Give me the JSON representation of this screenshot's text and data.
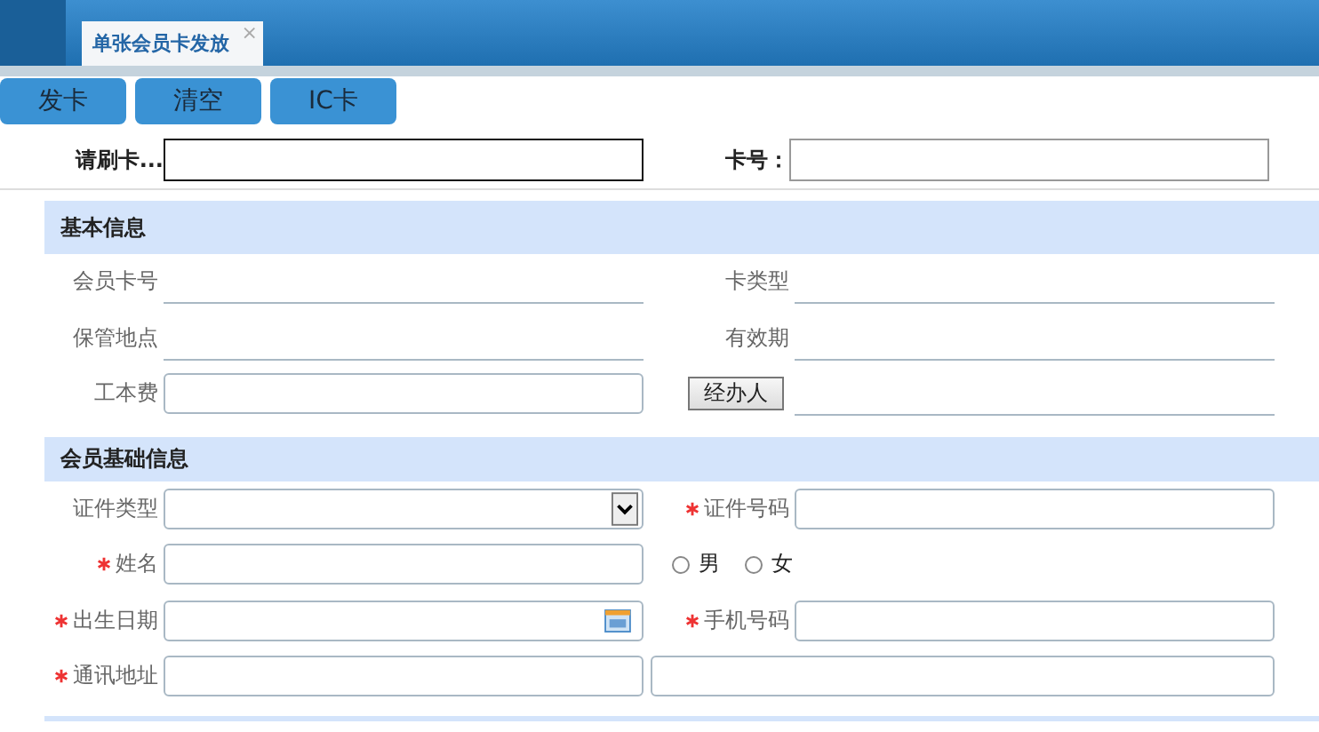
{
  "tabs": [
    {
      "label": "单张会员卡发放",
      "selected": true,
      "close": "×"
    }
  ],
  "toolbar": [
    "发卡",
    "清空",
    "IC卡"
  ],
  "swipe": [
    {
      "label": "请刷卡...",
      "focused": true
    },
    {
      "label": "卡号："
    }
  ],
  "sections": [
    {
      "title": "基本信息",
      "rows": [
        [
          {
            "kind": "underline",
            "label": "会员卡号",
            "required": false
          },
          {
            "kind": "underline",
            "label": "卡类型",
            "required": false
          }
        ],
        [
          {
            "kind": "underline",
            "label": "保管地点",
            "required": false
          },
          {
            "kind": "underline",
            "label": "有效期",
            "required": false
          }
        ],
        [
          {
            "kind": "input",
            "label": "工本费",
            "required": false
          },
          {
            "kind": "button-underline",
            "label": "经办人",
            "required": false
          }
        ]
      ]
    },
    {
      "title": "会员基础信息",
      "rows": [
        [
          {
            "kind": "select",
            "label": "证件类型",
            "required": false
          },
          {
            "kind": "input",
            "label": "证件号码",
            "required": true
          }
        ],
        [
          {
            "kind": "input",
            "label": "姓名",
            "required": true
          },
          {
            "kind": "radio",
            "options": [
              {
                "label": "男",
                "selected": false
              },
              {
                "label": "女",
                "selected": false
              }
            ]
          }
        ],
        [
          {
            "kind": "date",
            "label": "出生日期",
            "required": true
          },
          {
            "kind": "input",
            "label": "手机号码",
            "required": true
          }
        ],
        [
          {
            "kind": "input",
            "label": "通讯地址",
            "required": true
          },
          {
            "kind": "input-wide"
          }
        ]
      ]
    }
  ]
}
